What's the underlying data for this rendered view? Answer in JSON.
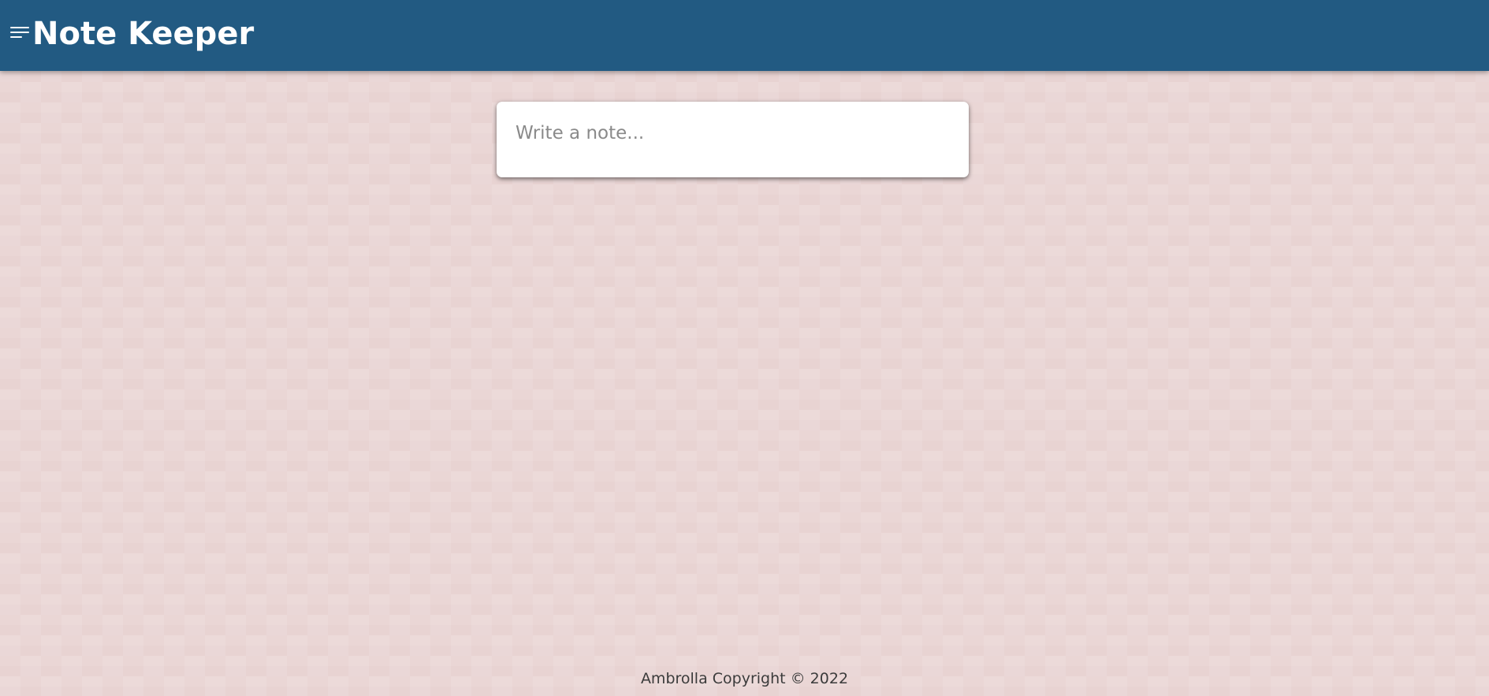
{
  "header": {
    "title": "Note Keeper",
    "menu_icon": "menu-icon",
    "background_color": "#225a82"
  },
  "note_composer": {
    "placeholder": "Write a note...",
    "value": ""
  },
  "footer": {
    "text": "Ambrolla Copyright © 2022"
  },
  "page": {
    "background_color": "#ead6d5"
  }
}
